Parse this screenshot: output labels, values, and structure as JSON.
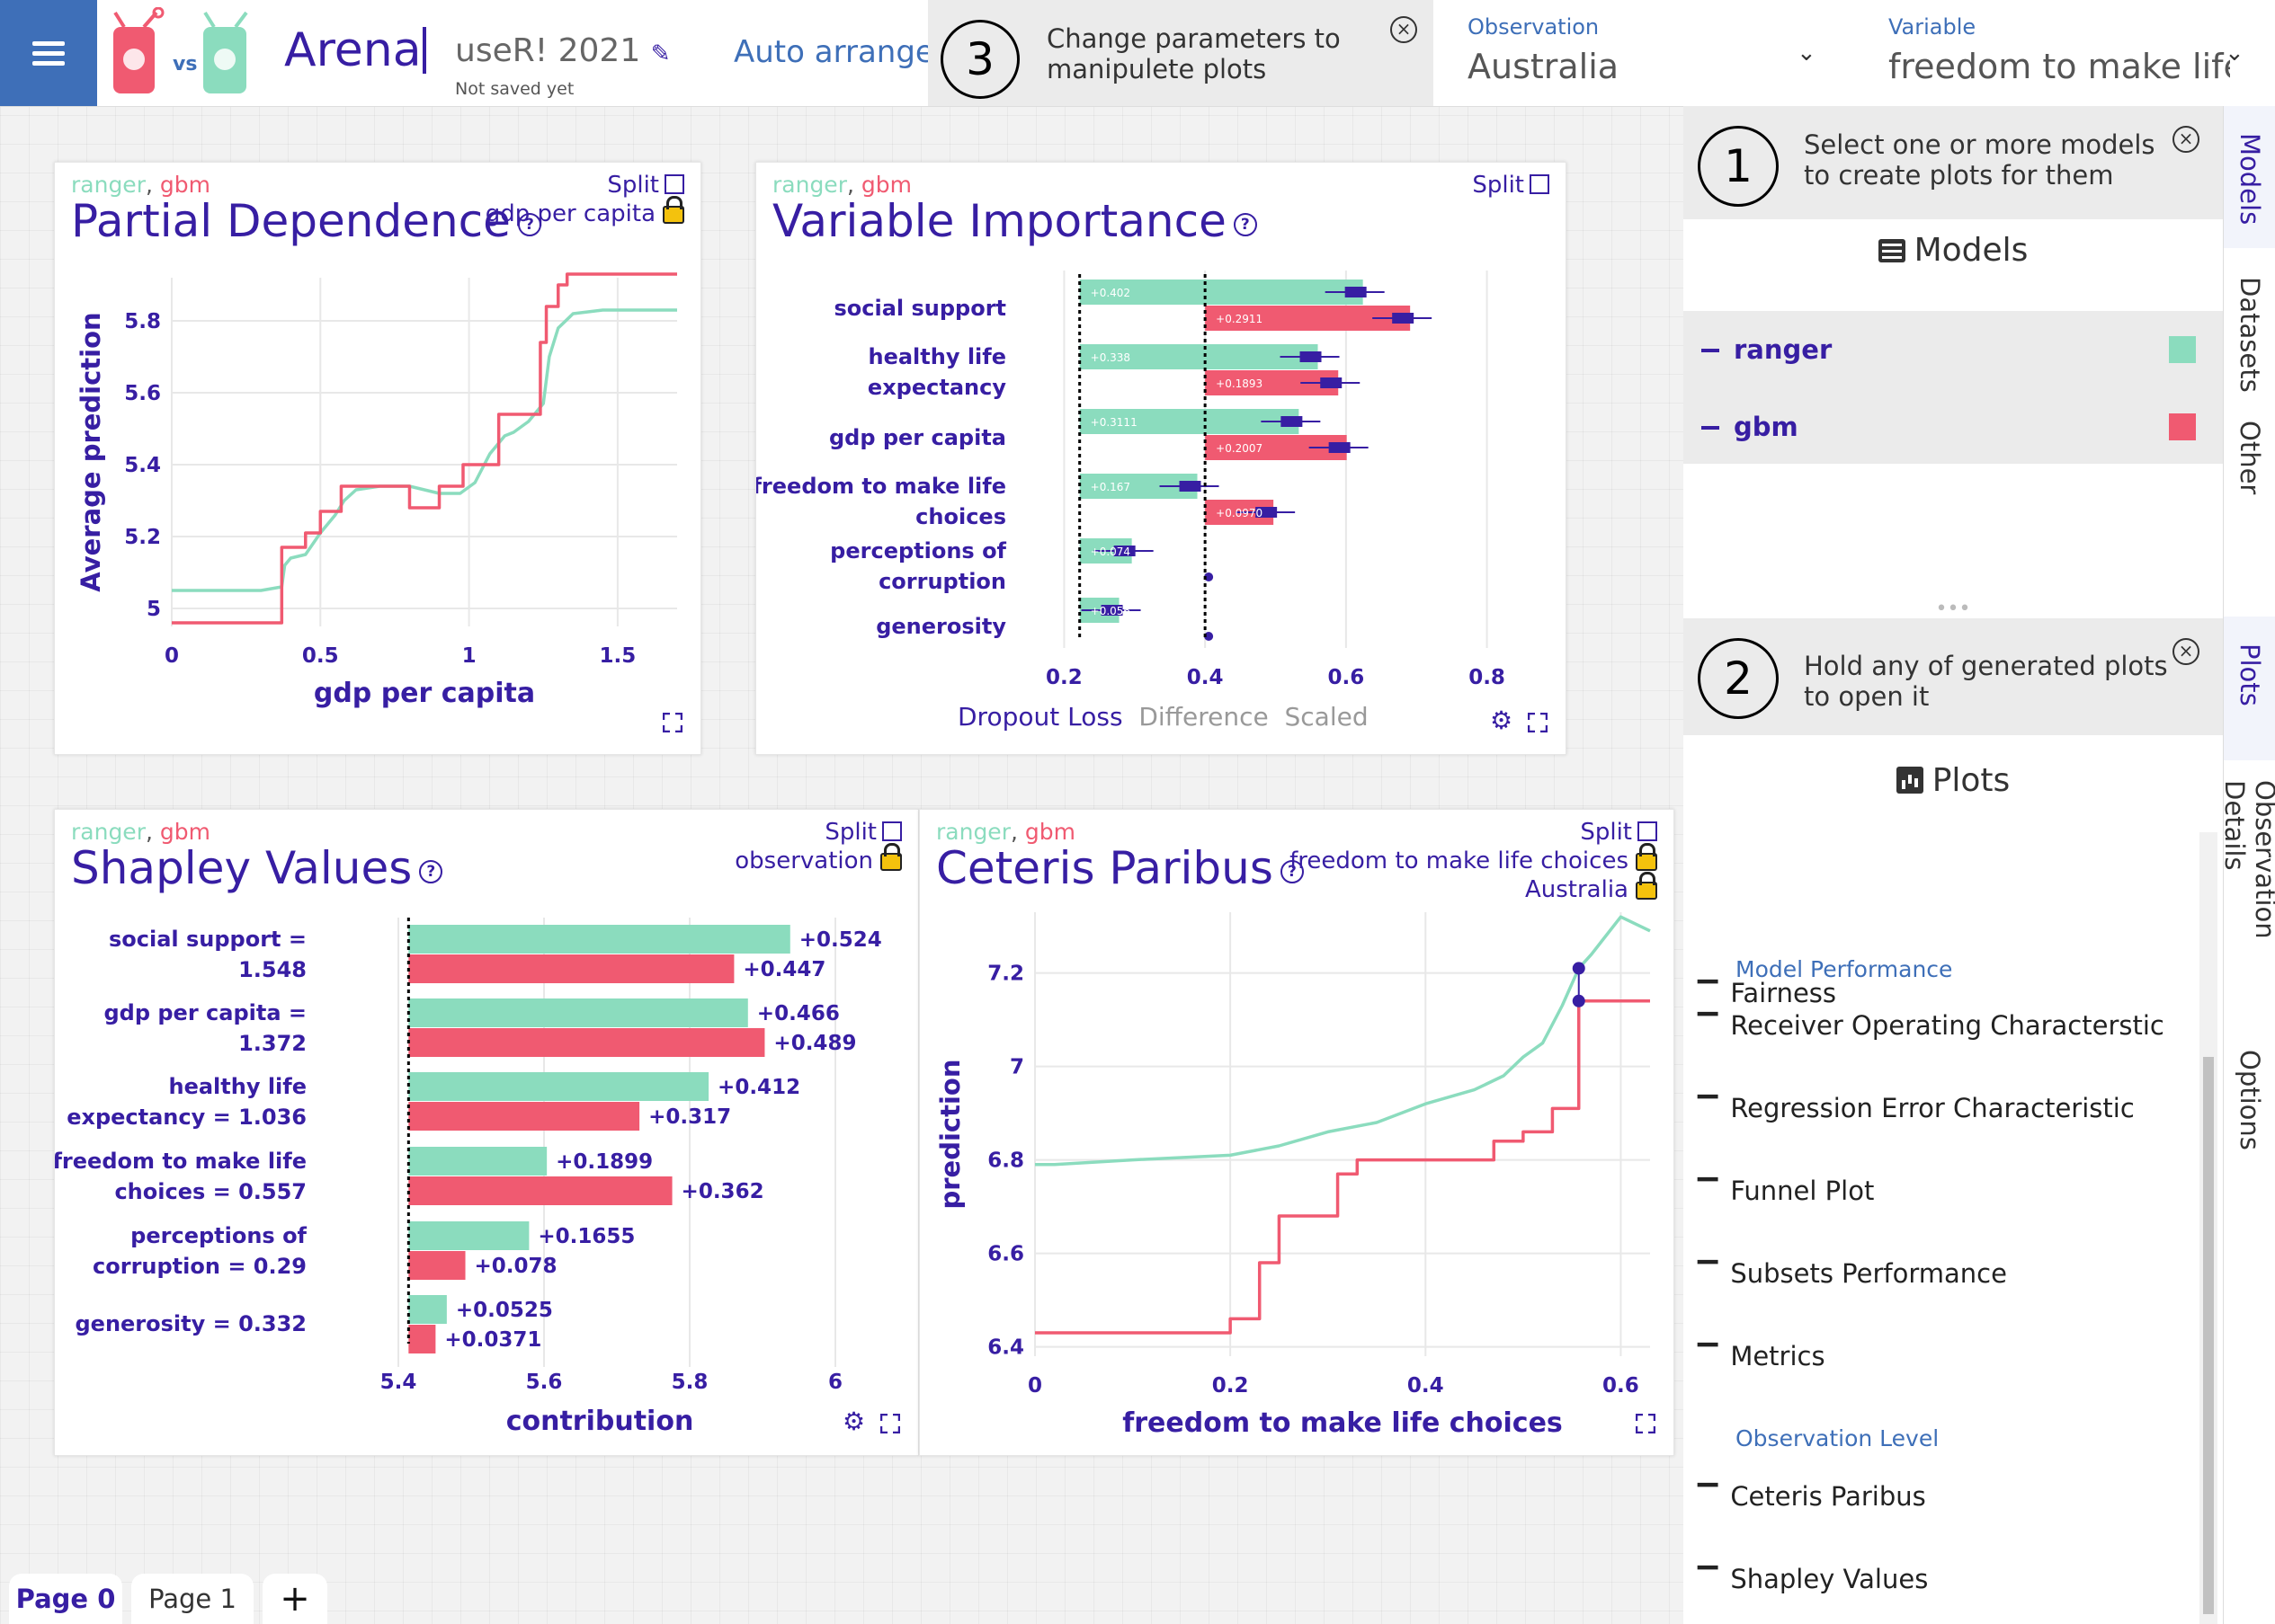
{
  "header": {
    "title": "Arena",
    "vs": "vs",
    "session_name": "useR! 2021",
    "save_status": "Not saved yet",
    "auto_arrange": "Auto arrange",
    "hint3_num": "3",
    "hint3_text": "Change parameters to manipulete plots",
    "observation_label": "Observation",
    "observation_value": "Australia",
    "variable_label": "Variable",
    "variable_value": "freedom to make life ..."
  },
  "colors": {
    "ranger": "#8bdcbe",
    "gbm": "#f05a71",
    "navy": "#371ea3",
    "accent": "#3e6fb8"
  },
  "legend": {
    "ranger": "ranger",
    "sep": ",",
    "gbm": "gbm"
  },
  "common": {
    "split": "Split"
  },
  "pdp": {
    "title": "Partial Dependence",
    "lock_label": "gdp per capita",
    "chart_data": {
      "type": "line",
      "xlabel": "gdp per capita",
      "ylabel": "Average prediction",
      "xlim": [
        0,
        1.7
      ],
      "ylim": [
        4.95,
        5.92
      ],
      "xticks": [
        "0",
        "0.5",
        "1",
        "1.5"
      ],
      "xtick_values": [
        0,
        0.5,
        1,
        1.5
      ],
      "yticks": [
        "5",
        "5.2",
        "5.4",
        "5.6",
        "5.8"
      ],
      "ytick_values": [
        5,
        5.2,
        5.4,
        5.6,
        5.8
      ],
      "series": [
        {
          "name": "ranger",
          "x": [
            0,
            0.3,
            0.37,
            0.38,
            0.4,
            0.45,
            0.5,
            0.55,
            0.58,
            0.62,
            0.7,
            0.8,
            0.9,
            0.97,
            1.02,
            1.07,
            1.12,
            1.15,
            1.2,
            1.25,
            1.27,
            1.3,
            1.35,
            1.45,
            1.6,
            1.7
          ],
          "y": [
            5.05,
            5.05,
            5.06,
            5.12,
            5.14,
            5.15,
            5.21,
            5.26,
            5.3,
            5.33,
            5.34,
            5.34,
            5.32,
            5.32,
            5.35,
            5.43,
            5.48,
            5.49,
            5.52,
            5.57,
            5.7,
            5.78,
            5.82,
            5.83,
            5.83,
            5.83
          ]
        },
        {
          "name": "gbm",
          "x": [
            0,
            0.37,
            0.37,
            0.45,
            0.45,
            0.5,
            0.5,
            0.57,
            0.57,
            0.8,
            0.8,
            0.9,
            0.9,
            0.98,
            0.98,
            1.1,
            1.1,
            1.24,
            1.24,
            1.26,
            1.26,
            1.3,
            1.3,
            1.33,
            1.33,
            1.7
          ],
          "y": [
            4.96,
            4.96,
            5.17,
            5.17,
            5.21,
            5.21,
            5.27,
            5.27,
            5.34,
            5.34,
            5.28,
            5.28,
            5.34,
            5.34,
            5.4,
            5.4,
            5.54,
            5.54,
            5.74,
            5.74,
            5.84,
            5.84,
            5.9,
            5.9,
            5.93,
            5.93
          ]
        }
      ]
    }
  },
  "vi": {
    "title": "Variable Importance",
    "modes": [
      "Dropout Loss",
      "Difference",
      "Scaled"
    ],
    "chart_data": {
      "type": "bar",
      "xlim": [
        0.2,
        0.8
      ],
      "xticks": [
        "0.2",
        "0.4",
        "0.6",
        "0.8"
      ],
      "xtick_values": [
        0.2,
        0.4,
        0.6,
        0.8
      ],
      "baseline": {
        "ranger": 0.222,
        "gbm": 0.4
      },
      "categories": [
        [
          "social support"
        ],
        [
          "healthy life",
          "expectancy"
        ],
        [
          "gdp per capita"
        ],
        [
          "freedom to make life",
          "choices"
        ],
        [
          "perceptions of",
          "corruption"
        ],
        [
          "generosity"
        ]
      ],
      "series": [
        {
          "name": "ranger",
          "values": [
            0.624,
            0.56,
            0.533,
            0.389,
            0.296,
            0.278
          ],
          "labels": [
            "+0.402",
            "+0.338",
            "+0.3111",
            "+0.167",
            "+0.074",
            "+0.056"
          ]
        },
        {
          "name": "gbm",
          "values": [
            0.691,
            0.589,
            0.601,
            0.497,
            0.404,
            0.403
          ],
          "labels": [
            "+0.2911",
            "+0.1893",
            "+0.2007",
            "+0.0970",
            "",
            ""
          ]
        }
      ]
    }
  },
  "shap": {
    "title": "Shapley Values",
    "lock_label": "observation",
    "chart_data": {
      "type": "bar",
      "xlabel": "contribution",
      "xlim": [
        5.4,
        6.05
      ],
      "xticks": [
        "5.4",
        "5.6",
        "5.8",
        "6"
      ],
      "xtick_values": [
        5.4,
        5.6,
        5.8,
        6.0
      ],
      "baseline": 5.414,
      "categories": [
        [
          "social support =",
          "1.548"
        ],
        [
          "gdp per capita =",
          "1.372"
        ],
        [
          "healthy life",
          "expectancy = 1.036"
        ],
        [
          "freedom to make life",
          "choices = 0.557"
        ],
        [
          "perceptions of",
          "corruption = 0.29"
        ],
        [
          "generosity = 0.332"
        ]
      ],
      "series": [
        {
          "name": "ranger",
          "values": [
            0.524,
            0.466,
            0.412,
            0.1899,
            0.1655,
            0.0525
          ],
          "labels": [
            "+0.524",
            "+0.466",
            "+0.412",
            "+0.1899",
            "+0.1655",
            "+0.0525"
          ]
        },
        {
          "name": "gbm",
          "values": [
            0.447,
            0.489,
            0.317,
            0.362,
            0.078,
            0.0371
          ],
          "labels": [
            "+0.447",
            "+0.489",
            "+0.317",
            "+0.362",
            "+0.078",
            "+0.0371"
          ]
        }
      ]
    }
  },
  "cp": {
    "title": "Ceteris Paribus",
    "lock_variable": "freedom to make life choices",
    "lock_observation": "Australia",
    "chart_data": {
      "type": "line",
      "xlabel": "freedom to make life choices",
      "ylabel": "prediction",
      "xlim": [
        0,
        0.63
      ],
      "ylim": [
        6.38,
        7.33
      ],
      "xticks": [
        "0",
        "0.2",
        "0.4",
        "0.6"
      ],
      "xtick_values": [
        0,
        0.2,
        0.4,
        0.6
      ],
      "yticks": [
        "6.4",
        "6.6",
        "6.8",
        "7",
        "7.2"
      ],
      "ytick_values": [
        6.4,
        6.6,
        6.8,
        7.0,
        7.2
      ],
      "series": [
        {
          "name": "ranger",
          "x": [
            0,
            0.02,
            0.1,
            0.2,
            0.25,
            0.3,
            0.35,
            0.4,
            0.45,
            0.48,
            0.5,
            0.52,
            0.54,
            0.557,
            0.57,
            0.6,
            0.63
          ],
          "y": [
            6.79,
            6.79,
            6.8,
            6.81,
            6.83,
            6.86,
            6.88,
            6.92,
            6.95,
            6.98,
            7.02,
            7.05,
            7.13,
            7.21,
            7.24,
            7.32,
            7.29
          ]
        },
        {
          "name": "gbm",
          "x": [
            0,
            0.2,
            0.2,
            0.23,
            0.23,
            0.25,
            0.25,
            0.31,
            0.31,
            0.33,
            0.33,
            0.47,
            0.47,
            0.5,
            0.5,
            0.53,
            0.53,
            0.557,
            0.557,
            0.63
          ],
          "y": [
            6.43,
            6.43,
            6.46,
            6.46,
            6.58,
            6.58,
            6.68,
            6.68,
            6.77,
            6.77,
            6.8,
            6.8,
            6.84,
            6.84,
            6.86,
            6.86,
            6.91,
            6.91,
            7.14,
            7.14
          ]
        }
      ],
      "observation": {
        "x": 0.557,
        "ranger": 7.21,
        "gbm": 7.14
      }
    }
  },
  "sidebar": {
    "hint1_num": "1",
    "hint1_text": "Select one or more models to create plots for them",
    "models_heading": "Models",
    "models": [
      {
        "name": "ranger",
        "color": "#8bdcbe"
      },
      {
        "name": "gbm",
        "color": "#f05a71"
      }
    ],
    "hint2_num": "2",
    "hint2_text": "Hold any of generated plots to open it",
    "plots_heading": "Plots",
    "plot_items": [
      "Fairness",
      "Receiver Operating Characterstic",
      "Regression Error Characteristic",
      "Funnel Plot",
      "Subsets Performance",
      "Metrics",
      "Ceteris Paribus",
      "Shapley Values"
    ],
    "category_model_performance": "Model Performance",
    "category_observation_level": "Observation Level"
  },
  "side_tabs": [
    "Models",
    "Datasets",
    "Other",
    "Plots",
    "Observation Details",
    "Options"
  ],
  "pages": [
    "Page 0",
    "Page 1"
  ],
  "add_page": "+"
}
